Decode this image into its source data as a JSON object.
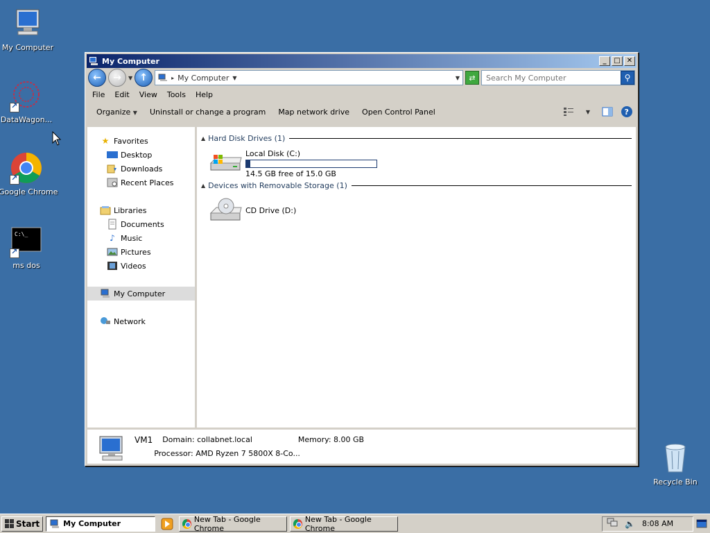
{
  "desktop": {
    "icons": [
      {
        "label": "My Computer"
      },
      {
        "label": "DataWagon..."
      },
      {
        "label": "Google Chrome"
      },
      {
        "label": "ms dos"
      },
      {
        "label": "Recycle Bin"
      }
    ]
  },
  "window": {
    "title": "My Computer",
    "address": "My Computer",
    "search_placeholder": "Search My Computer",
    "menu": [
      "File",
      "Edit",
      "View",
      "Tools",
      "Help"
    ],
    "commands": {
      "organize": "Organize",
      "uninstall": "Uninstall or change a program",
      "map_drive": "Map network drive",
      "control_panel": "Open Control Panel"
    },
    "nav": {
      "favorites": "Favorites",
      "desktop": "Desktop",
      "downloads": "Downloads",
      "recent": "Recent Places",
      "libraries": "Libraries",
      "documents": "Documents",
      "music": "Music",
      "pictures": "Pictures",
      "videos": "Videos",
      "my_computer": "My Computer",
      "network": "Network"
    },
    "groups": {
      "hdd_header": "Hard Disk Drives (1)",
      "removable_header": "Devices with Removable Storage (1)"
    },
    "drives": {
      "local_name": "Local Disk (C:)",
      "local_free": "14.5 GB free of 15.0 GB",
      "local_used_fraction": 0.033,
      "cd_name": "CD Drive (D:)"
    },
    "details": {
      "name": "VM1",
      "domain": "Domain: collabnet.local",
      "memory": "Memory: 8.00 GB",
      "processor": "Processor: AMD Ryzen 7 5800X 8-Co..."
    }
  },
  "taskbar": {
    "start": "Start",
    "tasks": [
      "My Computer",
      "New Tab - Google Chrome",
      "New Tab - Google Chrome"
    ],
    "clock": "8:08 AM"
  }
}
